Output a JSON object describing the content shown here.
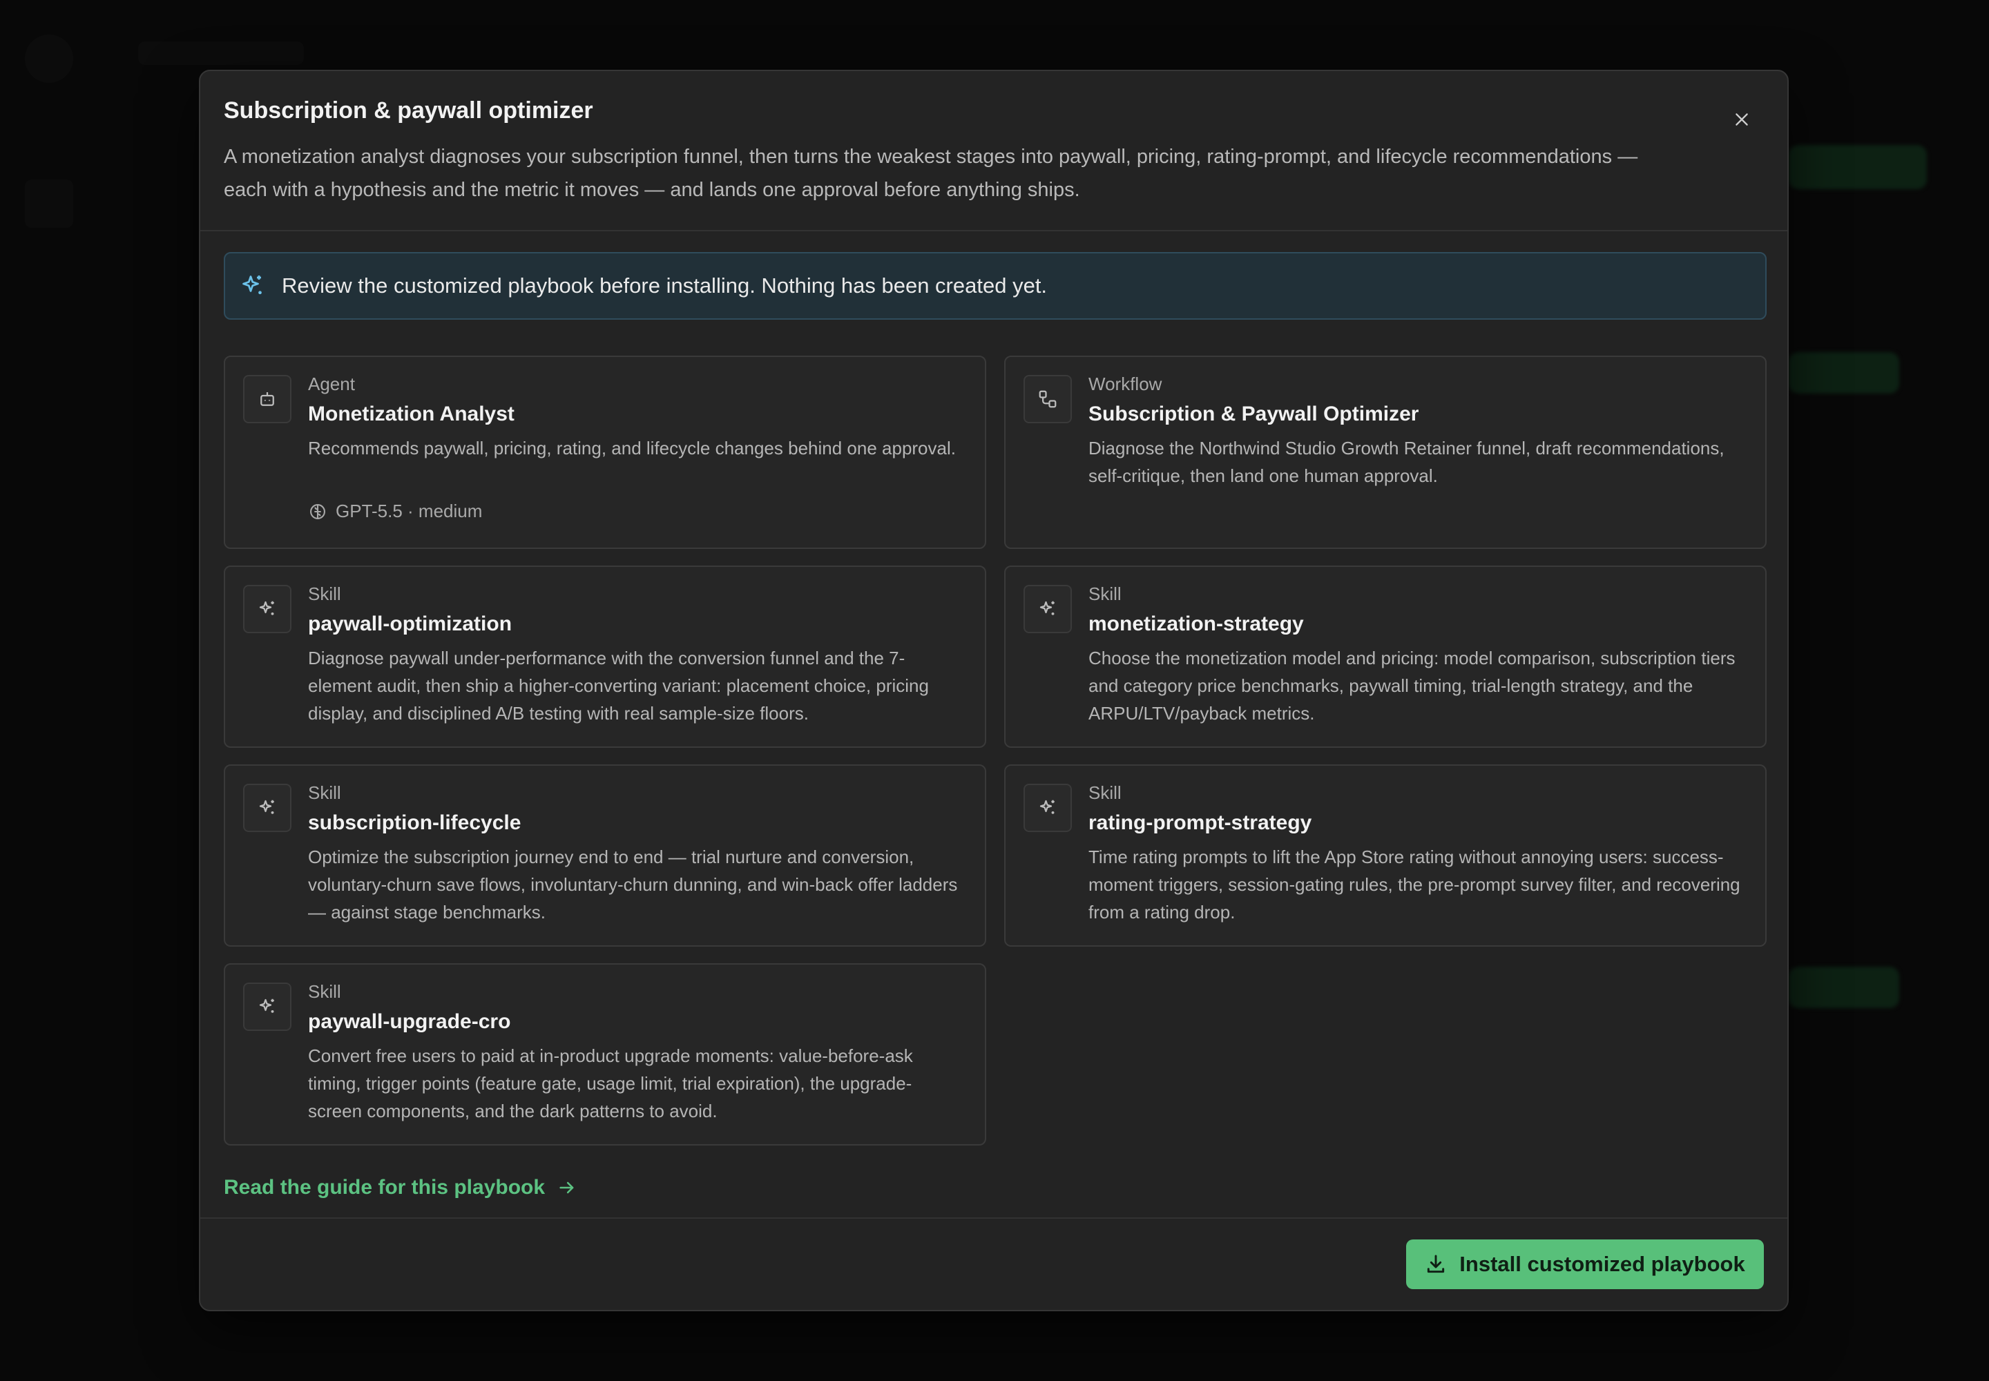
{
  "modal": {
    "title": "Subscription & paywall optimizer",
    "description": "A monetization analyst diagnoses your subscription funnel, then turns the weakest stages into paywall, pricing, rating-prompt, and lifecycle recommendations — each with a hypothesis and the metric it moves — and lands one approval before anything ships.",
    "close_icon": "close-icon"
  },
  "banner": {
    "icon": "sparkles-icon",
    "text": "Review the customized playbook before installing. Nothing has been created yet."
  },
  "cards": [
    {
      "kind": "Agent",
      "icon": "robot-icon",
      "name": "Monetization Analyst",
      "description": "Recommends paywall, pricing, rating, and lifecycle changes behind one approval.",
      "meta": "GPT-5.5 · medium",
      "meta_icon": "brain-icon"
    },
    {
      "kind": "Workflow",
      "icon": "workflow-icon",
      "name": "Subscription & Paywall Optimizer",
      "description": "Diagnose the Northwind Studio Growth Retainer funnel, draft recommendations, self-critique, then land one human approval."
    },
    {
      "kind": "Skill",
      "icon": "sparkles-icon",
      "name": "paywall-optimization",
      "description": "Diagnose paywall under-performance with the conversion funnel and the 7-element audit, then ship a higher-converting variant: placement choice, pricing display, and disciplined A/B testing with real sample-size floors."
    },
    {
      "kind": "Skill",
      "icon": "sparkles-icon",
      "name": "monetization-strategy",
      "description": "Choose the monetization model and pricing: model comparison, subscription tiers and category price benchmarks, paywall timing, trial-length strategy, and the ARPU/LTV/payback metrics."
    },
    {
      "kind": "Skill",
      "icon": "sparkles-icon",
      "name": "subscription-lifecycle",
      "description": "Optimize the subscription journey end to end — trial nurture and conversion, voluntary-churn save flows, involuntary-churn dunning, and win-back offer ladders — against stage benchmarks."
    },
    {
      "kind": "Skill",
      "icon": "sparkles-icon",
      "name": "rating-prompt-strategy",
      "description": "Time rating prompts to lift the App Store rating without annoying users: success-moment triggers, session-gating rules, the pre-prompt survey filter, and recovering from a rating drop."
    },
    {
      "kind": "Skill",
      "icon": "sparkles-icon",
      "name": "paywall-upgrade-cro",
      "description": "Convert free users to paid at in-product upgrade moments: value-before-ask timing, trigger points (feature gate, usage limit, trial expiration), the upgrade-screen components, and the dark patterns to avoid."
    }
  ],
  "guide_link": {
    "label": "Read the guide for this playbook",
    "icon": "arrow-right-icon"
  },
  "install_button": {
    "label": "Install customized playbook",
    "icon": "download-icon"
  },
  "colors": {
    "accent": "#58c07a",
    "link": "#5cc282",
    "banner_bg": "#213038",
    "modal_bg": "#232323"
  }
}
